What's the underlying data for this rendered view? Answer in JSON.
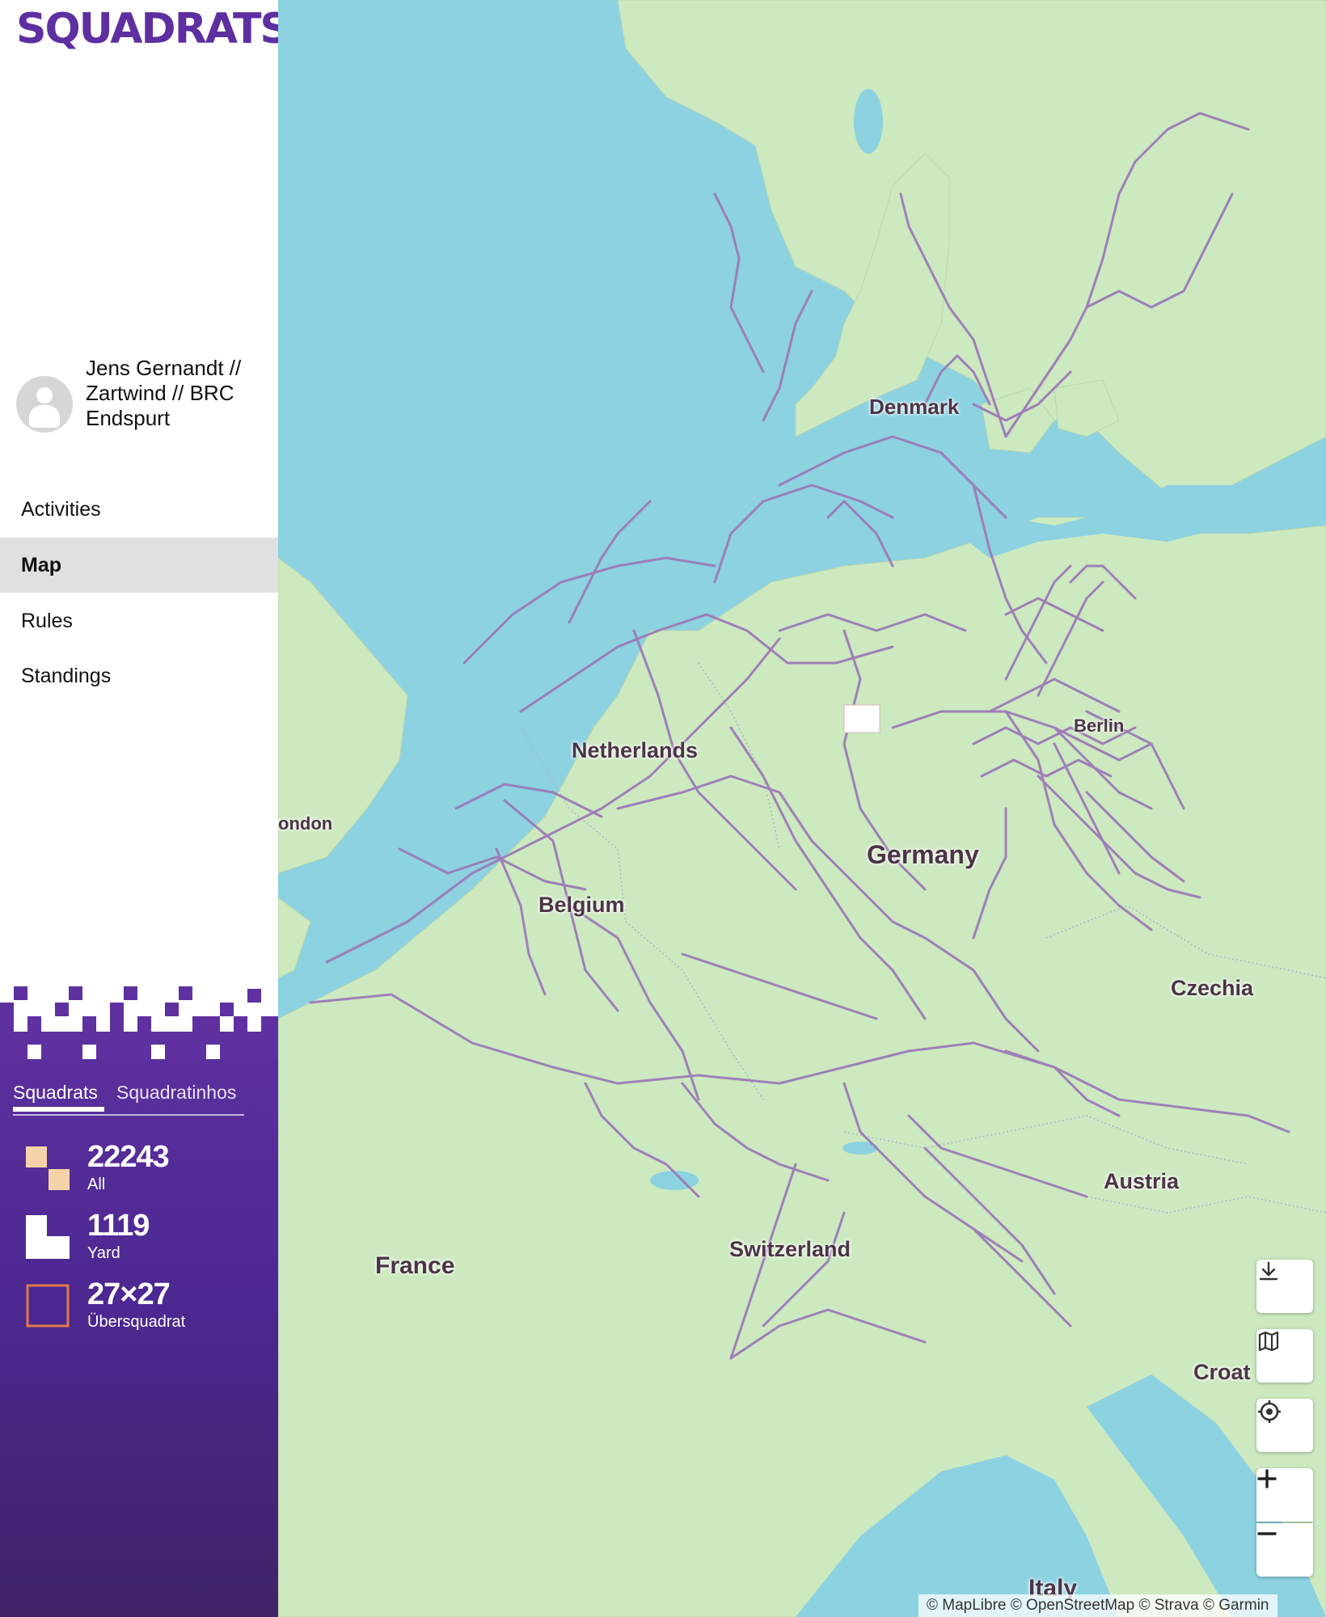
{
  "app": {
    "logo": "SQUADRATS"
  },
  "user": {
    "name": "Jens Gernandt // Zartwind // BRC Endspurt"
  },
  "nav": {
    "items": [
      {
        "label": "Activities",
        "active": false
      },
      {
        "label": "Map",
        "active": true
      },
      {
        "label": "Rules",
        "active": false
      },
      {
        "label": "Standings",
        "active": false
      }
    ]
  },
  "stats": {
    "tabs": [
      {
        "label": "Squadrats",
        "active": true
      },
      {
        "label": "Squadratinhos",
        "active": false
      }
    ],
    "items": [
      {
        "value": "22243",
        "label": "All",
        "icon": "squadrats-all-icon"
      },
      {
        "value": "1119",
        "label": "Yard",
        "icon": "yard-icon"
      },
      {
        "value": "27×27",
        "label": "Übersquadrat",
        "icon": "ubersquadrat-icon"
      }
    ]
  },
  "map": {
    "labels": {
      "denmark": "Denmark",
      "berlin": "Berlin",
      "netherlands": "Netherlands",
      "london": "ondon",
      "germany": "Germany",
      "belgium": "Belgium",
      "czechia": "Czechia",
      "austria": "Austria",
      "france": "France",
      "switzerland": "Switzerland",
      "croatia": "Croat",
      "italy": "Italy"
    },
    "attribution": "© MapLibre © OpenStreetMap © Strava © Garmin",
    "controls": [
      "download-icon",
      "map-layers-icon",
      "locate-icon",
      "zoom-in-icon",
      "zoom-out-icon"
    ],
    "colors": {
      "water": "#8cd2e1",
      "land": "#cde9c0",
      "tracks": "#9d7ab8"
    }
  },
  "colors": {
    "brand": "#5e2fa0",
    "sidebar_active": "#e0e0e0",
    "stat_all": "#f6d2a8",
    "stat_ubersquadrat": "#e07a4a"
  }
}
